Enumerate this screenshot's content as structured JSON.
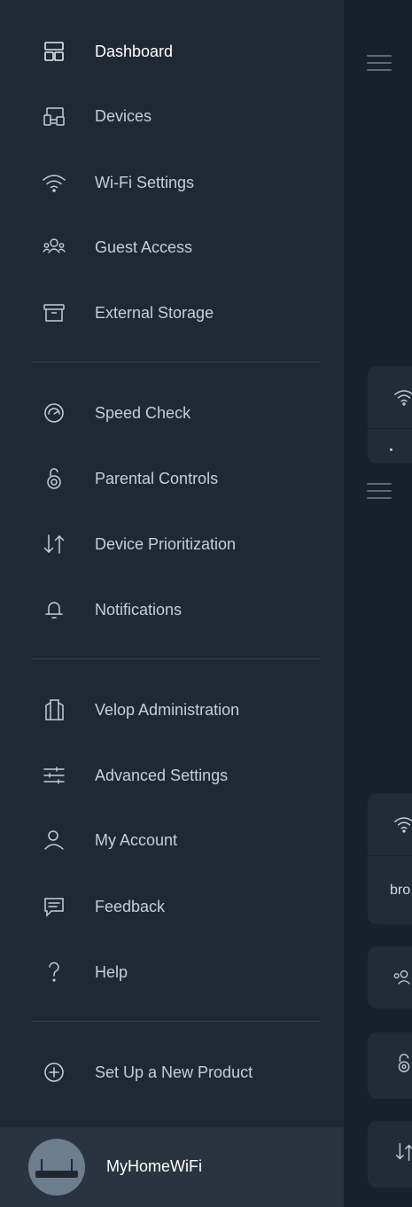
{
  "menu": {
    "section1": [
      {
        "label": "Dashboard",
        "icon": "dashboard-icon",
        "active": true
      },
      {
        "label": "Devices",
        "icon": "devices-icon"
      },
      {
        "label": "Wi-Fi Settings",
        "icon": "wifi-icon"
      },
      {
        "label": "Guest Access",
        "icon": "guest-access-icon"
      },
      {
        "label": "External Storage",
        "icon": "storage-box-icon"
      }
    ],
    "section2": [
      {
        "label": "Speed Check",
        "icon": "speedometer-icon"
      },
      {
        "label": "Parental Controls",
        "icon": "lock-icon"
      },
      {
        "label": "Device Prioritization",
        "icon": "priority-arrows-icon"
      },
      {
        "label": "Notifications",
        "icon": "bell-icon"
      }
    ],
    "section3": [
      {
        "label": "Velop Administration",
        "icon": "velop-node-icon"
      },
      {
        "label": "Advanced Settings",
        "icon": "sliders-icon"
      },
      {
        "label": "My Account",
        "icon": "user-icon"
      },
      {
        "label": "Feedback",
        "icon": "feedback-icon"
      },
      {
        "label": "Help",
        "icon": "help-question-icon"
      }
    ],
    "section4": [
      {
        "label": "Set Up a New Product",
        "icon": "plus-circle-icon"
      }
    ]
  },
  "footer": {
    "network_name": "MyHomeWiFi",
    "avatar_icon": "router-avatar-icon"
  },
  "background": {
    "card_text": "bro"
  },
  "colors": {
    "drawer_bg": "#1f2934",
    "footer_bg": "#2a3440",
    "app_bg": "#17212d",
    "text_active": "#ffffff",
    "text_normal": "#c7ced6"
  }
}
